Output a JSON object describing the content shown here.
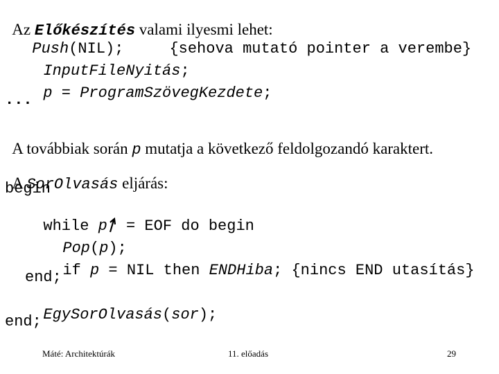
{
  "slide": {
    "line1": {
      "prefix": "Az ",
      "term": "Előkészítés",
      "suffix": " valami ilyesmi lehet:"
    },
    "line2": {
      "code": "Push",
      "args": "(NIL);",
      "gap": "     ",
      "comment": "{sehova mutató pointer a verembe}"
    },
    "line3": {
      "code": "InputFileNyitás",
      "end": ";"
    },
    "line4": {
      "var": "p",
      "eq": " = ",
      "code": "ProgramSzövegKezdete",
      "end": ";"
    },
    "line5": {
      "text": "..."
    },
    "line6": {
      "prefix": "A továbbiak során ",
      "var": "p",
      "suffix": " mutatja a következő feldolgozandó karaktert."
    },
    "line7": {
      "prefix": "A ",
      "term": "SorOlvasás",
      "suffix": " eljárás:"
    },
    "code": {
      "begin": "begin",
      "while_kw": "while ",
      "while_var": "p",
      "while_rest": " = EOF do begin",
      "pop": "Pop",
      "pop_open": "(",
      "pop_arg": "p",
      "pop_close": ");",
      "if_kw": "if ",
      "if_var": "p",
      "if_rest": " = NIL then ",
      "if_call": "ENDHiba",
      "if_semi": "; ",
      "if_comment": "{nincs END utasítás}",
      "end_inner": "end;",
      "egy": "EgySorOlvasás",
      "egy_open": "(",
      "egy_arg": "sor",
      "egy_close": ");",
      "end_outer": "end;"
    },
    "arrow_icon": "up-arrow-icon"
  },
  "footer": {
    "author": "Máté: Architektúrák",
    "lecture": "11. előadás",
    "page": "29"
  }
}
